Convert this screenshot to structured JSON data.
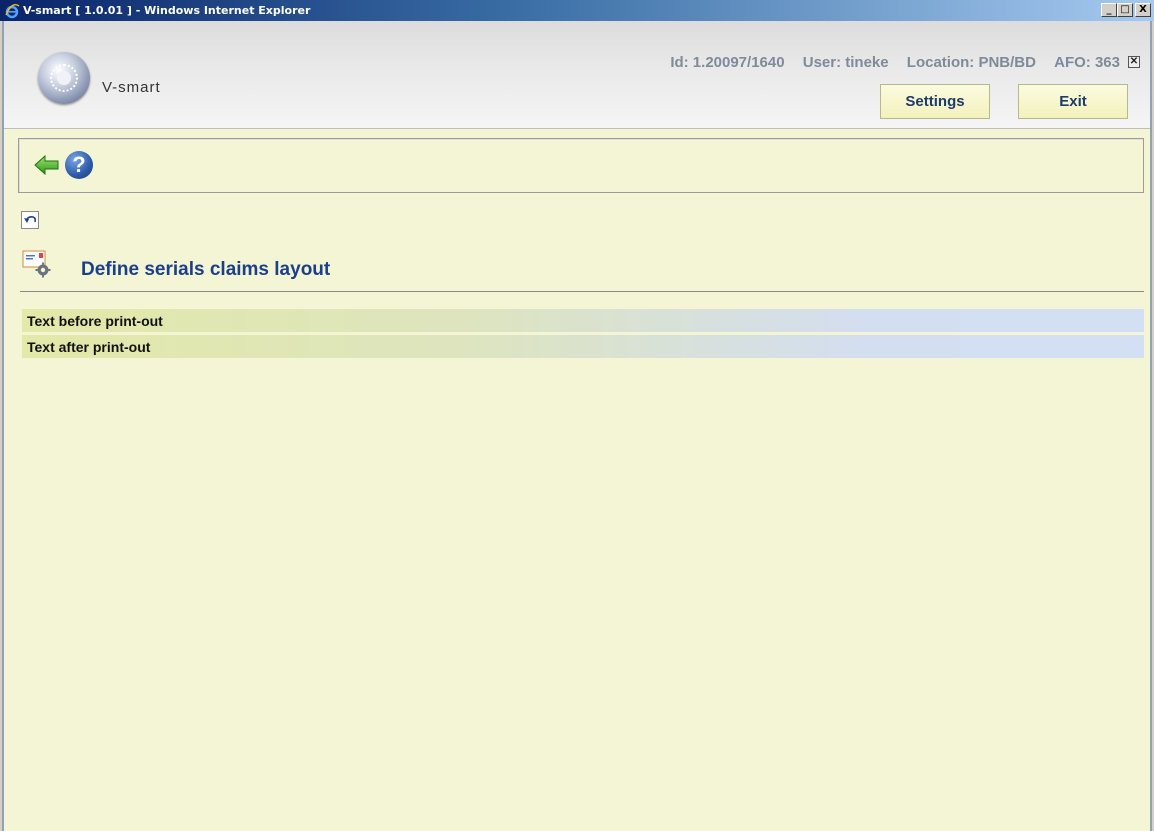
{
  "window": {
    "title": "V-smart [ 1.0.01 ] - Windows Internet Explorer",
    "controls": {
      "minimize": "_",
      "maximize": "□",
      "close": "X"
    }
  },
  "header": {
    "app_name": "V-smart",
    "id": "Id: 1.20097/1640",
    "user": "User: tineke",
    "location": "Location: PNB/BD",
    "afo": "AFO: 363",
    "close_glyph": "✕",
    "settings_label": "Settings",
    "exit_label": "Exit"
  },
  "toolbar": {
    "icons": [
      "back-arrow-icon",
      "help-icon"
    ],
    "help_glyph": "?"
  },
  "page": {
    "title": "Define serials claims layout",
    "items": [
      {
        "label": "Text before print-out"
      },
      {
        "label": "Text after print-out"
      }
    ]
  },
  "colors": {
    "background": "#f4f5d4",
    "title_text": "#1c3f8c",
    "button_text": "#1d3b6b",
    "row_left": "#e3e9a8",
    "row_right": "#d3e0f4"
  }
}
